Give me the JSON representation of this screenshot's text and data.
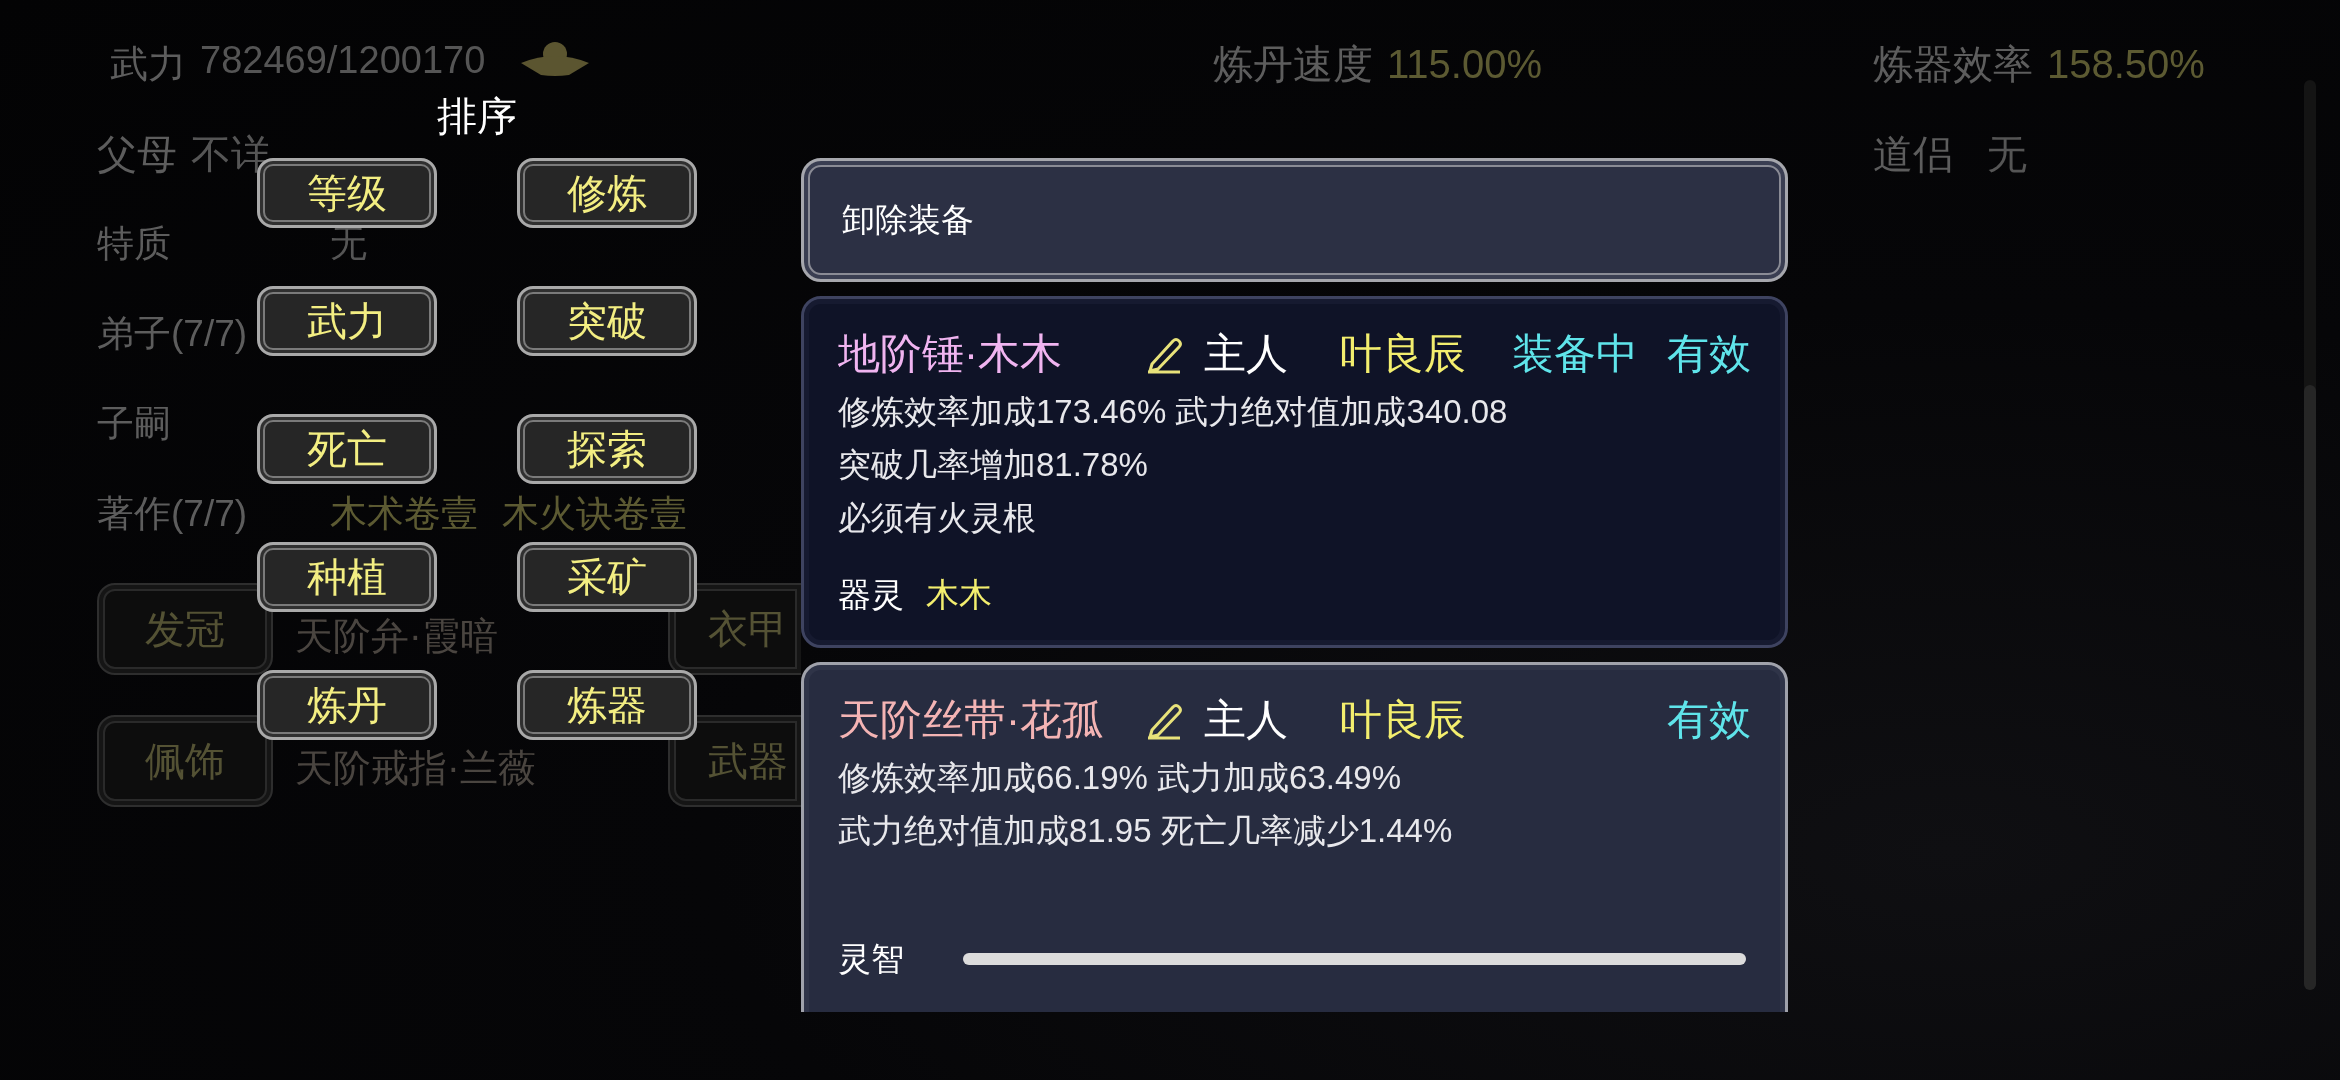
{
  "attributes": [
    {
      "kind": "power",
      "label": "武力",
      "values": [
        "782469/1200170"
      ]
    },
    {
      "kind": "info",
      "label": "父母",
      "values": [
        "不详"
      ]
    },
    {
      "kind": "trait",
      "label": "特质",
      "values": [
        "无"
      ]
    },
    {
      "kind": "trait",
      "label": "弟子(7/7)"
    },
    {
      "kind": "trait",
      "label": "子嗣"
    },
    {
      "kind": "names",
      "label": "著作(7/7)",
      "values": [
        "木术卷壹",
        "木火诀卷壹"
      ]
    }
  ],
  "equipment_slots": [
    {
      "slot": "发冠",
      "item": "天阶弁·霞暗"
    },
    {
      "slot": "衣甲"
    },
    {
      "slot": "佩饰",
      "item": "天阶戒指·兰薇"
    },
    {
      "slot": "武器"
    }
  ],
  "craft_stats": [
    {
      "label": "炼丹速度",
      "value": "115.00%"
    }
  ],
  "partner_stats": [
    {
      "label": "炼器效率",
      "value": "158.50%",
      "kind": "rate"
    },
    {
      "label": "道侣",
      "value": "无",
      "kind": "info"
    }
  ],
  "sort_menu": {
    "title": "排序",
    "options": [
      "等级",
      "修炼",
      "武力",
      "突破",
      "死亡",
      "探索",
      "种植",
      "采矿",
      "炼丹",
      "炼器"
    ]
  },
  "equipment_panel": {
    "unequip_button": "卸除装备",
    "items": [
      {
        "name": "地阶锤·木木",
        "color": "#f0b4f0",
        "owner_label": "主人",
        "owner": "叶良辰",
        "equipped_label": "装备中",
        "status": "有效",
        "effects": [
          "修炼效率加成173.46% 武力绝对值加成340.08",
          "突破几率增加81.78%",
          "必须有火灵根"
        ],
        "spirit": {
          "kind": "named",
          "label": "器灵",
          "name": "木木"
        }
      },
      {
        "name": "天阶丝带·花孤",
        "color": "#f4b4b4",
        "owner_label": "主人",
        "owner": "叶良辰",
        "status": "有效",
        "effects": [
          "修炼效率加成66.19% 武力加成63.49%",
          "武力绝对值加成81.95 死亡几率减少1.44%"
        ],
        "spirit": {
          "kind": "meter",
          "label": "灵智",
          "level": 1
        }
      }
    ]
  }
}
